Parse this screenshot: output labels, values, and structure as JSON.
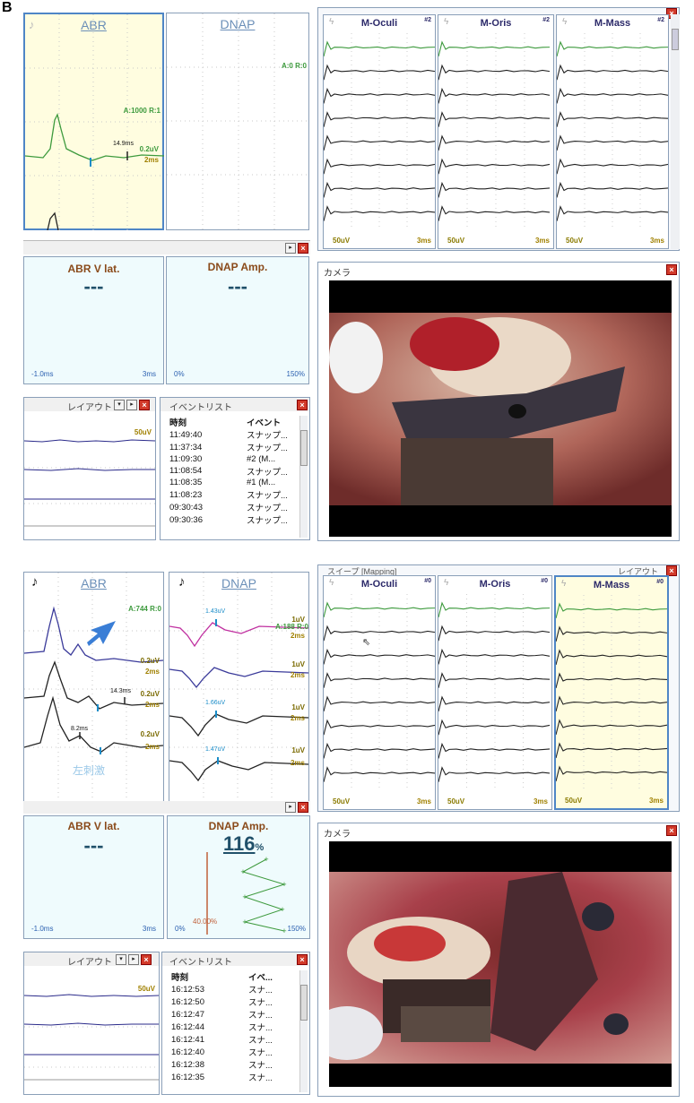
{
  "figure_label": "B",
  "top": {
    "abr_title": "ABR",
    "dnap_title": "DNAP",
    "abr_avg": "A:1000 R:1",
    "abr_latency": "14.9ms",
    "abr_amp": "0.2uV",
    "abr_time": "2ms",
    "dnap_avg": "A:0 R:0",
    "emg_titles": [
      "M-Oculi",
      "M-Oris",
      "M-Mass"
    ],
    "emg_badges": [
      "#2",
      "#2",
      "#2"
    ],
    "emg_scale": "50uV",
    "emg_time": "3ms",
    "abrv_title": "ABR V lat.",
    "abrv_value": "---",
    "abrv_min": "-1.0ms",
    "abrv_max": "3ms",
    "dnap_amp_title": "DNAP Amp.",
    "dnap_amp_value": "---",
    "dnap_amp_min": "0%",
    "dnap_amp_max": "150%",
    "camera_title": "カメラ",
    "layout_title": "レイアウト",
    "layout_scale": "50uV",
    "eventlist_title": "イベントリスト",
    "ev_col_time": "時刻",
    "ev_col_event": "イベント",
    "events": [
      {
        "t": "11:49:40",
        "e": "スナップ..."
      },
      {
        "t": "11:37:34",
        "e": "スナップ..."
      },
      {
        "t": "11:09:30",
        "e": "#2 (M..."
      },
      {
        "t": "11:08:54",
        "e": "スナップ..."
      },
      {
        "t": "11:08:35",
        "e": "#1 (M..."
      },
      {
        "t": "11:08:23",
        "e": "スナップ..."
      },
      {
        "t": "09:30:43",
        "e": "スナップ..."
      },
      {
        "t": "09:30:36",
        "e": "スナップ..."
      }
    ]
  },
  "bottom": {
    "abr_title": "ABR",
    "dnap_title": "DNAP",
    "abr_avg": "A:744 R:0",
    "dnap_avg": "A:188 R:0",
    "abr_amps": [
      "0.2uV",
      "0.2uV",
      "0.2uV"
    ],
    "abr_times": [
      "2ms",
      "2ms",
      "2ms"
    ],
    "abr_latency1": "14.3ms",
    "abr_latency2": "8.2ms",
    "abr_side_label": "左刺激",
    "dnap_peak_labels": [
      "1.43uV",
      "1.66uV",
      "1.47uV"
    ],
    "dnap_amps": [
      "1uV",
      "1uV",
      "1uV",
      "1uV"
    ],
    "dnap_times": [
      "2ms",
      "2ms",
      "2ms",
      "2ms"
    ],
    "mapping_title": "スイープ [Mapping]",
    "layout_title_top": "レイアウト",
    "emg_titles": [
      "M-Oculi",
      "M-Oris",
      "M-Mass"
    ],
    "emg_badges": [
      "#0",
      "#0",
      "#0"
    ],
    "emg_scale": "50uV",
    "emg_time": "3ms",
    "abrv_title": "ABR V lat.",
    "abrv_value": "---",
    "abrv_min": "-1.0ms",
    "abrv_max": "3ms",
    "dnap_amp_title": "DNAP Amp.",
    "dnap_amp_value": "116",
    "dnap_amp_unit": "%",
    "dnap_amp_threshold": "40.00%",
    "dnap_amp_min": "0%",
    "dnap_amp_max": "150%",
    "camera_title": "カメラ",
    "layout_title": "レイアウト",
    "layout_scale": "50uV",
    "eventlist_title": "イベントリスト",
    "ev_col_time": "時刻",
    "ev_col_event": "イベ...",
    "events": [
      {
        "t": "16:12:53",
        "e": "スナ..."
      },
      {
        "t": "16:12:50",
        "e": "スナ..."
      },
      {
        "t": "16:12:47",
        "e": "スナ..."
      },
      {
        "t": "16:12:44",
        "e": "スナ..."
      },
      {
        "t": "16:12:41",
        "e": "スナ..."
      },
      {
        "t": "16:12:40",
        "e": "スナ..."
      },
      {
        "t": "16:12:38",
        "e": "スナ..."
      },
      {
        "t": "16:12:35",
        "e": "スナ..."
      }
    ]
  },
  "colors": {
    "panel_border": "#8a9fb8",
    "pale_yellow": "#fffde0",
    "cyan_bg": "#effbfd",
    "trace_green": "#3d9a3d",
    "trace_blue": "#3a3a9a",
    "trace_magenta": "#c030a0",
    "close_red": "#d23a2a"
  }
}
